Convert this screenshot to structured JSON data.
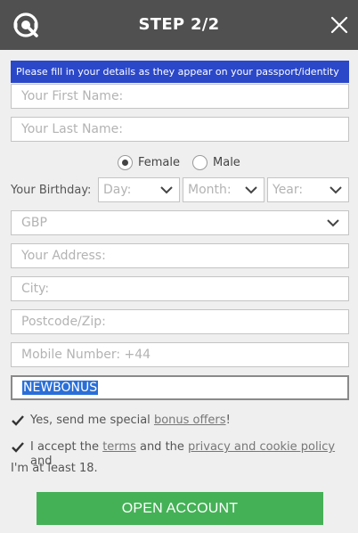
{
  "header": {
    "title": "STEP 2/2",
    "logo_icon": "headset-q-logo-icon",
    "close_icon": "close-icon",
    "background": "#505050"
  },
  "notice": {
    "text": "Please fill in your details as they appear on your passport/identity",
    "color": "#2b48c9"
  },
  "form": {
    "first_name": {
      "placeholder": "Your First Name:",
      "value": ""
    },
    "last_name": {
      "placeholder": "Your Last Name:",
      "value": ""
    },
    "gender": {
      "options": [
        "Female",
        "Male"
      ],
      "selected": "Female"
    },
    "birthday": {
      "label": "Your Birthday:",
      "day": "Day:",
      "month": "Month:",
      "year": "Year:"
    },
    "currency": {
      "selected": "GBP"
    },
    "address": {
      "placeholder": "Your Address:"
    },
    "city": {
      "placeholder": "City:"
    },
    "postcode": {
      "placeholder": "Postcode/Zip:"
    },
    "mobile": {
      "placeholder": "Mobile Number: +44"
    },
    "promo_code": {
      "value": "NEWBONUS"
    }
  },
  "consent": {
    "bonus": {
      "checked": true,
      "prefix": "Yes, send me special ",
      "link": "bonus offers",
      "suffix": "!"
    },
    "terms": {
      "checked": true,
      "prefix": "I accept the ",
      "terms_link": "terms",
      "middle": " and the ",
      "privacy_link": "privacy and cookie policy",
      "suffix": " and",
      "line2": "I'm at least 18."
    }
  },
  "submit": {
    "label": "OPEN ACCOUNT",
    "color": "#45b157"
  }
}
